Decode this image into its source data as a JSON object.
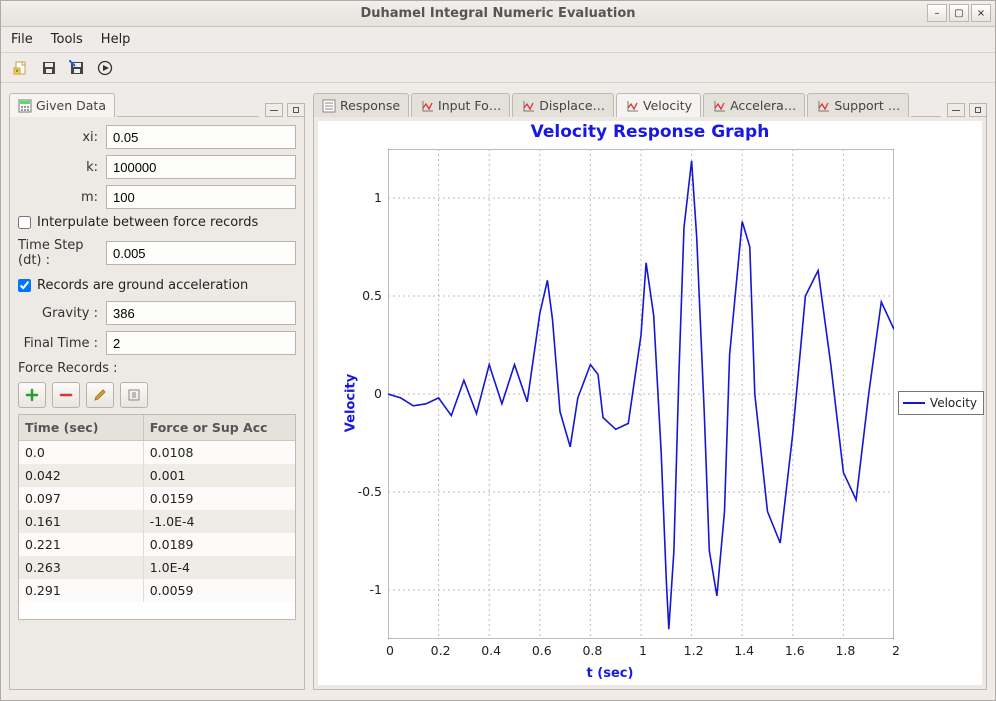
{
  "window": {
    "title": "Duhamel Integral Numeric Evaluation"
  },
  "menu": {
    "file": "File",
    "tools": "Tools",
    "help": "Help"
  },
  "toolbar_icons": {
    "new": "new-file-icon",
    "save": "save-icon",
    "saveas": "save-as-icon",
    "run": "run-icon"
  },
  "left": {
    "tab_label": "Given Data",
    "labels": {
      "xi": "xi:",
      "k": "k:",
      "m": "m:",
      "interp": "Interpulate between force records",
      "dt": "Time Step (dt) :",
      "ground": "Records are ground acceleration",
      "gravity": "Gravity :",
      "final_time": "Final Time :",
      "force_records": "Force Records :"
    },
    "values": {
      "xi": "0.05",
      "k": "100000",
      "m": "100",
      "dt": "0.005",
      "gravity": "386",
      "final_time": "2"
    },
    "checks": {
      "interp": false,
      "ground": true
    },
    "record_buttons": [
      "add",
      "remove",
      "edit",
      "import"
    ],
    "table_headers": [
      "Time (sec)",
      "Force or Sup Acc"
    ],
    "table_rows": [
      [
        "0.0",
        "0.0108"
      ],
      [
        "0.042",
        "0.001"
      ],
      [
        "0.097",
        "0.0159"
      ],
      [
        "0.161",
        "-1.0E-4"
      ],
      [
        "0.221",
        "0.0189"
      ],
      [
        "0.263",
        "1.0E-4"
      ],
      [
        "0.291",
        "0.0059"
      ]
    ]
  },
  "right_tabs": [
    "Response",
    "Input Fo…",
    "Displace…",
    "Velocity",
    "Accelera…",
    "Support …"
  ],
  "right_active_tab": 3,
  "chart_data": {
    "type": "line",
    "title": "Velocity Response Graph",
    "xlabel": "t (sec)",
    "ylabel": "Velocity",
    "xlim": [
      0,
      2
    ],
    "ylim": [
      -1.25,
      1.25
    ],
    "xticks": [
      0,
      0.2,
      0.4,
      0.6,
      0.8,
      1,
      1.2,
      1.4,
      1.6,
      1.8,
      2
    ],
    "yticks": [
      -1,
      -0.5,
      0,
      0.5,
      1
    ],
    "legend": [
      "Velocity"
    ],
    "series": [
      {
        "name": "Velocity",
        "x": [
          0.0,
          0.05,
          0.1,
          0.15,
          0.2,
          0.25,
          0.3,
          0.35,
          0.4,
          0.45,
          0.5,
          0.55,
          0.6,
          0.63,
          0.65,
          0.68,
          0.72,
          0.75,
          0.8,
          0.83,
          0.85,
          0.9,
          0.95,
          1.0,
          1.02,
          1.05,
          1.08,
          1.1,
          1.11,
          1.13,
          1.15,
          1.17,
          1.2,
          1.22,
          1.25,
          1.27,
          1.3,
          1.33,
          1.35,
          1.4,
          1.43,
          1.45,
          1.5,
          1.55,
          1.6,
          1.65,
          1.7,
          1.75,
          1.8,
          1.85,
          1.9,
          1.95,
          2.0
        ],
        "y": [
          0.0,
          -0.02,
          -0.06,
          -0.05,
          -0.02,
          -0.11,
          0.07,
          -0.1,
          0.15,
          -0.05,
          0.15,
          -0.04,
          0.41,
          0.58,
          0.38,
          -0.09,
          -0.27,
          -0.02,
          0.15,
          0.1,
          -0.12,
          -0.18,
          -0.15,
          0.3,
          0.67,
          0.4,
          -0.3,
          -0.95,
          -1.2,
          -0.8,
          0.1,
          0.85,
          1.19,
          0.8,
          -0.1,
          -0.8,
          -1.03,
          -0.6,
          0.2,
          0.88,
          0.75,
          0.0,
          -0.6,
          -0.76,
          -0.2,
          0.5,
          0.63,
          0.15,
          -0.4,
          -0.54,
          0.0,
          0.47,
          0.33
        ]
      }
    ]
  }
}
